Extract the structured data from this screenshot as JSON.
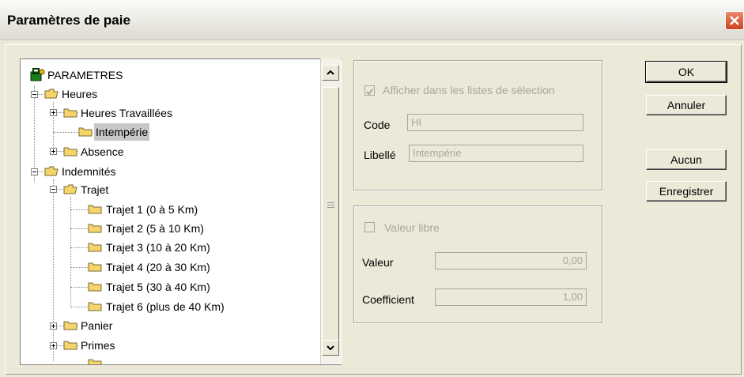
{
  "window": {
    "title": "Paramètres de paie"
  },
  "tree": {
    "root": "PARAMETRES",
    "heures": "Heures",
    "heures_travaillees": "Heures Travaillées",
    "intemperie": "Intempérie",
    "absence": "Absence",
    "indemnites": "Indemnités",
    "trajet": "Trajet",
    "trajet1": "Trajet 1 (0 à 5 Km)",
    "trajet2": "Trajet 2 (5 à 10 Km)",
    "trajet3": "Trajet 3 (10 à 20 Km)",
    "trajet4": "Trajet 4 (20 à 30 Km)",
    "trajet5": "Trajet 5 (30 à 40 Km)",
    "trajet6": "Trajet 6 (plus de 40 Km)",
    "panier": "Panier",
    "primes": "Primes"
  },
  "details": {
    "show_in_lists_label": "Afficher dans les listes de sélection",
    "show_in_lists_checked": true,
    "code_label": "Code",
    "code_value": "HI",
    "libelle_label": "Libellé",
    "libelle_value": "Intempérie"
  },
  "valeur": {
    "valeur_libre_label": "Valeur libre",
    "valeur_libre_checked": false,
    "valeur_label": "Valeur",
    "valeur_value": "0,00",
    "coefficient_label": "Coefficient",
    "coefficient_value": "1,00"
  },
  "buttons": {
    "ok": "OK",
    "annuler": "Annuler",
    "aucun": "Aucun",
    "enregistrer": "Enregistrer"
  },
  "colors": {
    "folder": "#f5d56b",
    "selection": "#c8c8c8",
    "disabled_text": "#a9a79c"
  }
}
